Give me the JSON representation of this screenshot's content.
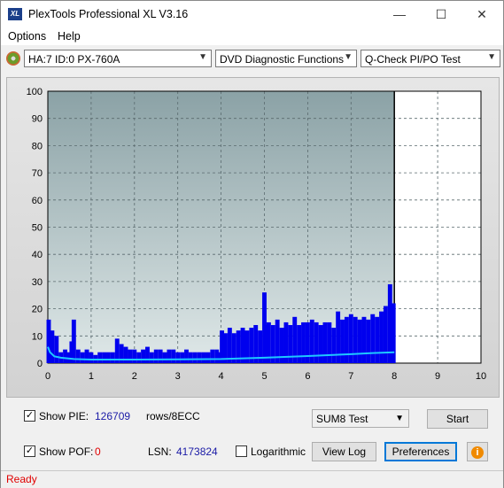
{
  "window": {
    "title": "PlexTools Professional XL V3.16",
    "icon_text": "XL",
    "minimize_glyph": "—",
    "maximize_glyph": "☐",
    "close_glyph": "✕"
  },
  "menu": {
    "items": [
      {
        "label": "Options"
      },
      {
        "label": "Help"
      }
    ]
  },
  "toolbar": {
    "drive": "HA:7 ID:0  PX-760A",
    "function": "DVD Diagnostic Functions",
    "test": "Q-Check PI/PO Test",
    "arrow": "▼"
  },
  "colors": {
    "plot_bg_top": "#8ba2a6",
    "plot_bg_bottom": "#dfe8e8",
    "pie_bars": "#0000ee",
    "pif_line": "#1ec8ff",
    "marker": "#000000"
  },
  "chart_data": {
    "type": "bar",
    "xlim": [
      0,
      10
    ],
    "ylim": [
      0,
      100
    ],
    "x_ticks": [
      "0",
      "1",
      "2",
      "3",
      "4",
      "5",
      "6",
      "7",
      "8",
      "9",
      "10"
    ],
    "y_ticks": [
      "0",
      "10",
      "20",
      "30",
      "40",
      "50",
      "60",
      "70",
      "80",
      "90",
      "100"
    ],
    "grid": true,
    "end_marker_x": 8.0,
    "series": [
      {
        "kind": "bars",
        "points": [
          [
            0.02,
            16
          ],
          [
            0.1,
            12
          ],
          [
            0.2,
            10
          ],
          [
            0.3,
            4
          ],
          [
            0.4,
            5
          ],
          [
            0.5,
            4
          ],
          [
            0.55,
            8
          ],
          [
            0.6,
            16
          ],
          [
            0.7,
            5
          ],
          [
            0.8,
            4
          ],
          [
            0.9,
            5
          ],
          [
            1.0,
            4
          ],
          [
            1.1,
            3
          ],
          [
            1.2,
            4
          ],
          [
            1.3,
            4
          ],
          [
            1.4,
            4
          ],
          [
            1.5,
            4
          ],
          [
            1.6,
            9
          ],
          [
            1.7,
            7
          ],
          [
            1.8,
            6
          ],
          [
            1.9,
            5
          ],
          [
            2.0,
            5
          ],
          [
            2.1,
            4
          ],
          [
            2.2,
            5
          ],
          [
            2.3,
            6
          ],
          [
            2.4,
            4
          ],
          [
            2.5,
            5
          ],
          [
            2.6,
            5
          ],
          [
            2.7,
            4
          ],
          [
            2.8,
            5
          ],
          [
            2.9,
            5
          ],
          [
            3.0,
            4
          ],
          [
            3.1,
            4
          ],
          [
            3.2,
            5
          ],
          [
            3.3,
            4
          ],
          [
            3.4,
            4
          ],
          [
            3.5,
            4
          ],
          [
            3.6,
            4
          ],
          [
            3.7,
            4
          ],
          [
            3.8,
            5
          ],
          [
            3.9,
            5
          ],
          [
            3.98,
            4
          ],
          [
            4.02,
            12
          ],
          [
            4.1,
            11
          ],
          [
            4.2,
            13
          ],
          [
            4.3,
            11
          ],
          [
            4.4,
            12
          ],
          [
            4.5,
            13
          ],
          [
            4.6,
            12
          ],
          [
            4.7,
            13
          ],
          [
            4.8,
            14
          ],
          [
            4.9,
            12
          ],
          [
            5.0,
            26
          ],
          [
            5.05,
            14
          ],
          [
            5.1,
            15
          ],
          [
            5.2,
            14
          ],
          [
            5.3,
            16
          ],
          [
            5.4,
            13
          ],
          [
            5.5,
            15
          ],
          [
            5.6,
            14
          ],
          [
            5.7,
            17
          ],
          [
            5.8,
            14
          ],
          [
            5.9,
            15
          ],
          [
            6.0,
            15
          ],
          [
            6.1,
            16
          ],
          [
            6.2,
            15
          ],
          [
            6.3,
            14
          ],
          [
            6.4,
            15
          ],
          [
            6.5,
            15
          ],
          [
            6.6,
            13
          ],
          [
            6.7,
            19
          ],
          [
            6.8,
            16
          ],
          [
            6.9,
            17
          ],
          [
            7.0,
            18
          ],
          [
            7.1,
            17
          ],
          [
            7.2,
            16
          ],
          [
            7.3,
            17
          ],
          [
            7.4,
            16
          ],
          [
            7.5,
            18
          ],
          [
            7.6,
            17
          ],
          [
            7.7,
            19
          ],
          [
            7.8,
            21
          ],
          [
            7.9,
            29
          ],
          [
            7.98,
            22
          ]
        ]
      },
      {
        "kind": "line",
        "points": [
          [
            0.0,
            6
          ],
          [
            0.05,
            4
          ],
          [
            0.15,
            2.5
          ],
          [
            0.3,
            2
          ],
          [
            0.6,
            1.5
          ],
          [
            1.0,
            1.3
          ],
          [
            2.0,
            1.3
          ],
          [
            3.0,
            1.4
          ],
          [
            4.0,
            1.5
          ],
          [
            5.0,
            2
          ],
          [
            6.0,
            2.6
          ],
          [
            7.0,
            3.3
          ],
          [
            7.5,
            3.7
          ],
          [
            8.0,
            4
          ]
        ]
      }
    ]
  },
  "controls": {
    "show_pie_label": "Show PIE:",
    "pie_value": "126709",
    "pie_unit": "rows/8ECC",
    "show_pof_label": "Show POF:",
    "pof_value": "0",
    "lsn_label": "LSN:",
    "lsn_value": "4173824",
    "logarithmic_label": "Logarithmic",
    "test_mode": "SUM8 Test",
    "start_label": "Start",
    "view_log_label": "View Log",
    "preferences_label": "Preferences",
    "info_glyph": "i",
    "checked_glyph": "✓"
  },
  "status": {
    "text": "Ready"
  }
}
